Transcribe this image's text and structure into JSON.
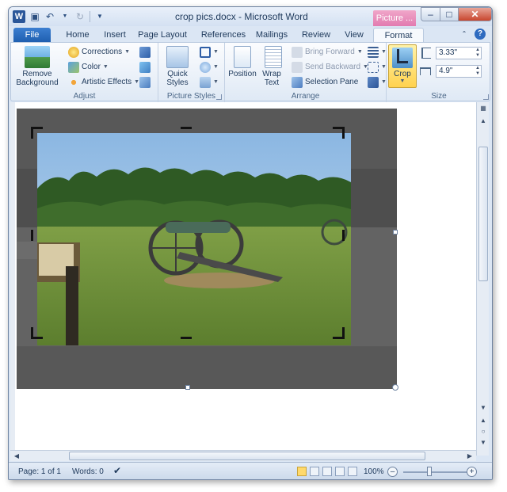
{
  "window": {
    "title": "crop pics.docx - Microsoft Word",
    "context_tab_header": "Picture ..."
  },
  "tabs": [
    "File",
    "Home",
    "Insert",
    "Page Layout",
    "References",
    "Mailings",
    "Review",
    "View",
    "Format"
  ],
  "ribbon": {
    "adjust": {
      "label": "Adjust",
      "remove_background": "Remove Background",
      "corrections": "Corrections",
      "color": "Color",
      "artistic_effects": "Artistic Effects"
    },
    "picture_styles": {
      "label": "Picture Styles",
      "quick_styles": "Quick Styles"
    },
    "arrange": {
      "label": "Arrange",
      "position": "Position",
      "wrap_text": "Wrap Text",
      "bring_forward": "Bring Forward",
      "send_backward": "Send Backward",
      "selection_pane": "Selection Pane"
    },
    "size": {
      "label": "Size",
      "crop": "Crop",
      "height": "3.33\"",
      "width": "4.9\""
    }
  },
  "status": {
    "page": "Page: 1 of 1",
    "words": "Words: 0",
    "zoom": "100%"
  },
  "colors": {
    "accent": "#2a5699",
    "context_tab": "#e27bb0",
    "crop_active": "#ffd24f",
    "cropped_area": "#5c5c5c"
  }
}
